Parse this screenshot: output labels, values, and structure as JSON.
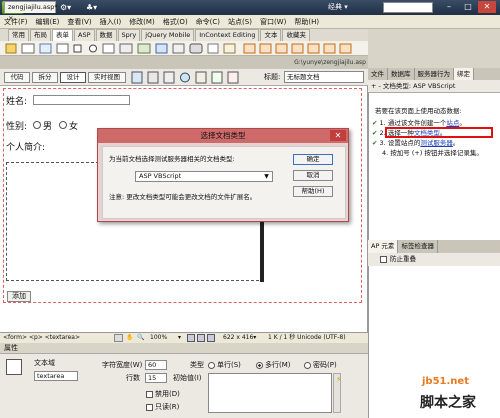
{
  "titlebar": {
    "logo": "Dw",
    "workspace": "经典 ▾",
    "icons": [
      "layout-icon",
      "gear-icon",
      "user-icon"
    ],
    "win_buttons": [
      "–",
      "□",
      "✕"
    ]
  },
  "menu": [
    "文件(F)",
    "编辑(E)",
    "查看(V)",
    "插入(I)",
    "修改(M)",
    "格式(O)",
    "命令(C)",
    "站点(S)",
    "窗口(W)",
    "帮助(H)"
  ],
  "insert_tabs": [
    {
      "label": "常用"
    },
    {
      "label": "布局"
    },
    {
      "label": "表单"
    },
    {
      "label": "ASP"
    },
    {
      "label": "数据"
    },
    {
      "label": "Spry"
    },
    {
      "label": "jQuery Mobile"
    },
    {
      "label": "InContext Editing"
    },
    {
      "label": "文本"
    },
    {
      "label": "收藏夹"
    }
  ],
  "document": {
    "tab": "zengjiajilu.asp*",
    "tab_close": "×",
    "path": "G:\\yunye\\zengjiajilu.asp",
    "views": [
      "代码",
      "拆分",
      "设计",
      "实时视图"
    ],
    "title_label": "标题:",
    "title_value": "无标题文档"
  },
  "form": {
    "name_label": "姓名:",
    "gender_label": "性别:",
    "male": "男",
    "female": "女",
    "intro_label": "个人简介:",
    "add_button": "添加"
  },
  "statusbar": {
    "path": "<form>  <p>  <textarea>",
    "zoom": "100%",
    "size": "622 x 416▾",
    "info": "1 K / 1 秒  Unicode (UTF-8)"
  },
  "properties": {
    "header": "属性",
    "field_type": "文本域",
    "field_name": "textarea",
    "char_width_label": "字符宽度(W)",
    "char_width": "60",
    "rows_label": "行数",
    "rows": "15",
    "type_label": "类型",
    "type_single": "单行(S)",
    "type_multi": "多行(M)",
    "type_password": "密码(P)",
    "init_label": "初始值(I)",
    "disabled": "禁用(D)",
    "readonly": "只读(R)"
  },
  "right_panel": {
    "tabs": [
      "文件",
      "数据库",
      "服务器行为",
      "绑定"
    ],
    "toolbar": "+ -  文档类型: ASP VBScript",
    "intro": "若要在该页面上使用动态数据:",
    "steps": [
      {
        "n": "1.",
        "pre": "通过该文件创建一个",
        "link": "站点",
        "post": "。"
      },
      {
        "n": "2.",
        "pre": "选择一种",
        "link": "文档类型",
        "post": "。"
      },
      {
        "n": "3.",
        "pre": "设置站点的",
        "link": "测试服务器",
        "post": "。"
      },
      {
        "n": "4.",
        "pre": "按加号 (+) 按钮并选择记录集。",
        "link": "",
        "post": ""
      }
    ],
    "ap_tabs": [
      "AP 元素",
      "标签检查器"
    ],
    "ap_prevent": "防止重叠"
  },
  "watermark": {
    "line1": "jb51.net",
    "line2": "脚本之家"
  },
  "dialog": {
    "title": "选择文档类型",
    "close": "✕",
    "prompt": "为当前文档选择测试服务器相关的文档类型:",
    "selected": "ASP VBScript",
    "note": "注意: 更改文档类型可能会更改文档的文件扩展名。",
    "ok": "确定",
    "cancel": "取消",
    "help": "帮助(H)"
  }
}
